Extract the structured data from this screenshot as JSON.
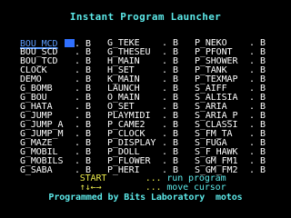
{
  "title": "Instant Program Launcher",
  "files": {
    "col1": [
      {
        "name": "BOU_MCD",
        "ext": "B"
      },
      {
        "name": "BOU_SCD",
        "ext": "B"
      },
      {
        "name": "BOU_TCD",
        "ext": "B"
      },
      {
        "name": "CLOCK",
        "ext": "B"
      },
      {
        "name": "DEMO",
        "ext": "B"
      },
      {
        "name": "G_BOMB",
        "ext": "B"
      },
      {
        "name": "G_BOU",
        "ext": "B"
      },
      {
        "name": "G_HATA",
        "ext": "B"
      },
      {
        "name": "G_JUMP",
        "ext": "B"
      },
      {
        "name": "G_JUMP_A",
        "ext": "B"
      },
      {
        "name": "G_JUMP_M",
        "ext": "B"
      },
      {
        "name": "G_MAZE",
        "ext": "B"
      },
      {
        "name": "G_MOBIL",
        "ext": "B"
      },
      {
        "name": "G_MOBILS",
        "ext": "B"
      },
      {
        "name": "G_SABA",
        "ext": "B"
      }
    ],
    "col2": [
      {
        "name": "G_TEKE",
        "ext": "B"
      },
      {
        "name": "G_THESEU",
        "ext": "B"
      },
      {
        "name": "H_MAIN",
        "ext": "B"
      },
      {
        "name": "H_SET",
        "ext": "B"
      },
      {
        "name": "K_MAIN",
        "ext": "B"
      },
      {
        "name": "LAUNCH",
        "ext": "B"
      },
      {
        "name": "O_MAIN",
        "ext": "B"
      },
      {
        "name": "O_SET",
        "ext": "B"
      },
      {
        "name": "PLAYMIDI",
        "ext": "B"
      },
      {
        "name": "P_CAME2",
        "ext": "B"
      },
      {
        "name": "P_CLOCK",
        "ext": "B"
      },
      {
        "name": "P_DISPLAY",
        "ext": "B"
      },
      {
        "name": "P_DOLL",
        "ext": "B"
      },
      {
        "name": "P_FLOWER",
        "ext": "B"
      },
      {
        "name": "P_HERI",
        "ext": "B"
      }
    ],
    "col3": [
      {
        "name": "P_NEKO",
        "ext": "B"
      },
      {
        "name": "P_PFONT",
        "ext": "B"
      },
      {
        "name": "P_SHOWER",
        "ext": "B"
      },
      {
        "name": "P_TANK",
        "ext": "B"
      },
      {
        "name": "P_TEXMAP",
        "ext": "B"
      },
      {
        "name": "S_AIFF",
        "ext": "B"
      },
      {
        "name": "S_ALISIA",
        "ext": "B"
      },
      {
        "name": "S_ARIA",
        "ext": "B"
      },
      {
        "name": "S_ARIA_P",
        "ext": "B"
      },
      {
        "name": "S_CLASSI",
        "ext": "B"
      },
      {
        "name": "S_FM_TA",
        "ext": "B"
      },
      {
        "name": "S_FUGA",
        "ext": "B"
      },
      {
        "name": "S_F_HAWK",
        "ext": "B"
      },
      {
        "name": "S_GM_FM1",
        "ext": "B"
      },
      {
        "name": "S_GM_FM2",
        "ext": "B"
      }
    ]
  },
  "selected": "BOU_MCD",
  "help": [
    {
      "key": "START",
      "dots": "...",
      "desc": "run program"
    },
    {
      "key": "↑↓←→",
      "dots": "...",
      "desc": "move cursor"
    }
  ],
  "footer": "Programmed by Bits Laboratory  motos",
  "colors": {
    "background": "#000000",
    "title": "#5ce8e8",
    "filename": "#ffffff",
    "cursor": "#3070ff",
    "key": "#e8e84a"
  }
}
